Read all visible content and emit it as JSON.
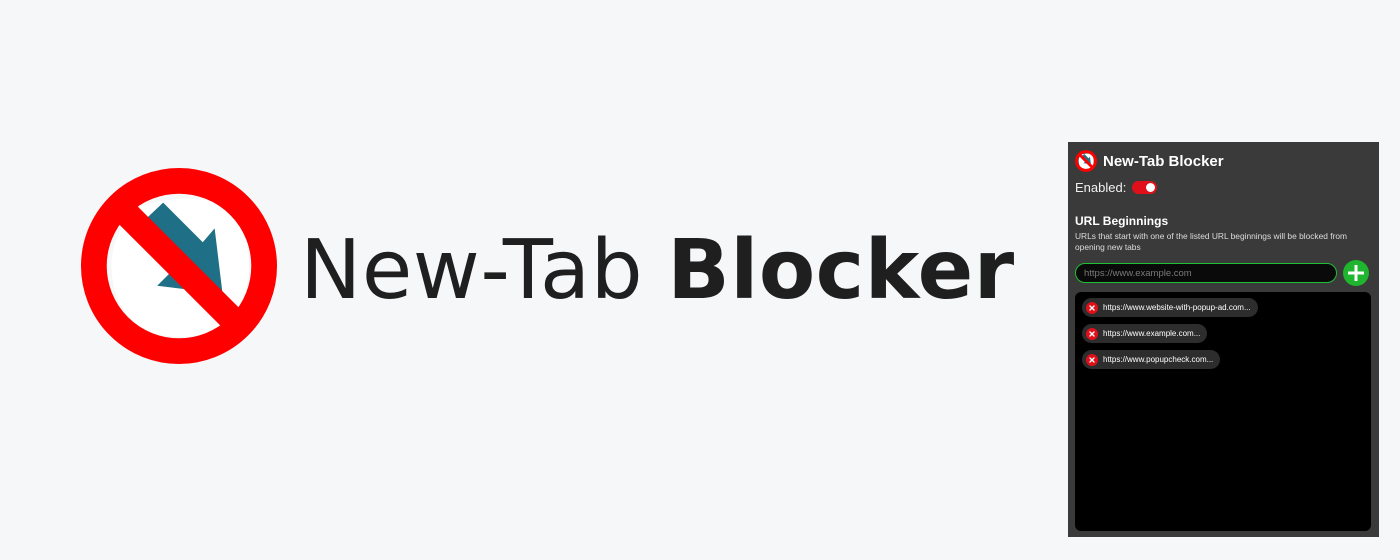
{
  "hero": {
    "title_light": "New-Tab",
    "title_bold": "Blocker"
  },
  "popup": {
    "title": "New-Tab Blocker",
    "enabled_label": "Enabled:",
    "enabled": true,
    "section_title": "URL Beginnings",
    "section_description": "URLs that start with one of the listed URL beginnings will be blocked from opening new tabs",
    "input": {
      "value": "",
      "placeholder": "https://www.example.com"
    },
    "urls": [
      "https://www.website-with-popup-ad.com...",
      "https://www.example.com...",
      "https://www.popupcheck.com..."
    ]
  },
  "colors": {
    "background": "#f6f7f9",
    "popup_background": "#3a3a3a",
    "list_background": "#000000",
    "toggle_on": "#e0101b",
    "add_button": "#1fb52f",
    "logo_red": "#ff0000",
    "logo_arrow": "#1f6f86"
  },
  "icons": {
    "logo": "no-new-tab-logo-icon",
    "add": "plus-icon",
    "remove": "x-icon"
  }
}
